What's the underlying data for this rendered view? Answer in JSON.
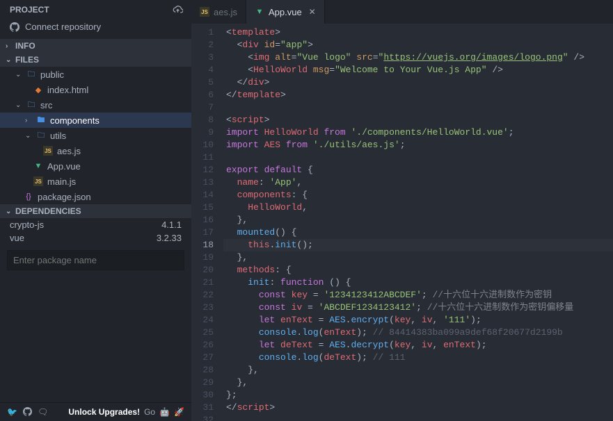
{
  "sidebar": {
    "project_label": "PROJECT",
    "connect_label": "Connect repository",
    "info_label": "INFO",
    "files_label": "FILES",
    "dependencies_label": "DEPENDENCIES",
    "tree": {
      "public": "public",
      "index_html": "index.html",
      "src": "src",
      "components": "components",
      "utils": "utils",
      "aes_js": "aes.js",
      "app_vue": "App.vue",
      "main_js": "main.js",
      "package_json": "package.json"
    },
    "deps": [
      {
        "name": "crypto-js",
        "ver": "4.1.1"
      },
      {
        "name": "vue",
        "ver": "3.2.33"
      }
    ],
    "pkg_placeholder": "Enter package name",
    "upgrade": "Unlock Upgrades!",
    "go": "Go"
  },
  "tabs": [
    {
      "icon": "js",
      "label": "aes.js"
    },
    {
      "icon": "vue",
      "label": "App.vue"
    }
  ],
  "code_tokens": {
    "l1": [
      "<",
      "template",
      ">"
    ],
    "l2": [
      "<",
      "div",
      " id",
      "=",
      "\"app\"",
      ">"
    ],
    "l3": [
      "<",
      "img",
      " alt",
      "=",
      "\"Vue logo\"",
      " src",
      "=",
      "\"",
      "https://vuejs.org/images/logo.png",
      "\"",
      " />"
    ],
    "l4": [
      "<",
      "HelloWorld",
      " msg",
      "=",
      "\"Welcome to Your Vue.js App\"",
      " />"
    ],
    "l5": [
      "</",
      "div",
      ">"
    ],
    "l6": [
      "</",
      "template",
      ">"
    ],
    "l8": [
      "<",
      "script",
      ">"
    ],
    "l9": [
      "import",
      " HelloWorld ",
      "from",
      " ",
      "'./components/HelloWorld.vue'",
      ";"
    ],
    "l10": [
      "import",
      " AES ",
      "from",
      " ",
      "'./utils/aes.js'",
      ";"
    ],
    "l12": [
      "export",
      " ",
      "default",
      " {"
    ],
    "l13": [
      "name",
      ": ",
      "'App'",
      ","
    ],
    "l14": [
      "components",
      ": {"
    ],
    "l15": [
      "HelloWorld",
      ","
    ],
    "l16": [
      "},"
    ],
    "l17": [
      "mounted",
      "() ",
      "{"
    ],
    "l18": [
      "this",
      ".",
      "init",
      "();"
    ],
    "l19": [
      "},"
    ],
    "l20": [
      "methods",
      ": {"
    ],
    "l21": [
      "init",
      ": ",
      "function",
      " () {"
    ],
    "l22": [
      "const",
      " ",
      "key",
      " = ",
      "'1234123412ABCDEF'",
      "; ",
      "//十六位十六进制数作为密钥"
    ],
    "l23": [
      "const",
      " ",
      "iv",
      " = ",
      "'ABCDEF1234123412'",
      "; ",
      "//十六位十六进制数作为密钥偏移量"
    ],
    "l24": [
      "let",
      " ",
      "enText",
      " = ",
      "AES",
      ".",
      "encrypt",
      "(",
      "key",
      ", ",
      "iv",
      ", ",
      "'111'",
      ");"
    ],
    "l25": [
      "console",
      ".",
      "log",
      "(",
      "enText",
      "); ",
      "// 84414383ba099a9def68f20677d2199b"
    ],
    "l26": [
      "let",
      " ",
      "deText",
      " = ",
      "AES",
      ".",
      "decrypt",
      "(",
      "key",
      ", ",
      "iv",
      ", ",
      "enText",
      ");"
    ],
    "l27": [
      "console",
      ".",
      "log",
      "(",
      "deText",
      "); ",
      "// 111"
    ],
    "l28": [
      "},"
    ],
    "l29": [
      "},"
    ],
    "l30": [
      "};"
    ],
    "l31": [
      "</",
      "script",
      ">"
    ]
  }
}
